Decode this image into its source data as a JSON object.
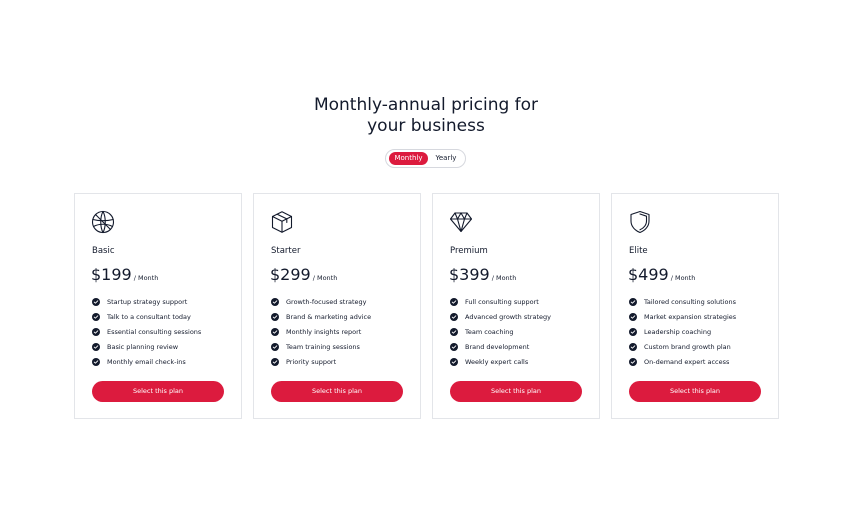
{
  "header": {
    "title_line1": "Monthly-annual pricing for",
    "title_line2": "your business"
  },
  "billing_toggle": {
    "monthly_label": "Monthly",
    "yearly_label": "Yearly",
    "selected": "Monthly"
  },
  "colors": {
    "accent": "#dc1b3e",
    "text": "#131a2c",
    "card_border": "#e3e5e9"
  },
  "plans": [
    {
      "icon": "dribbble-ball-icon",
      "name": "Basic",
      "price": "$199",
      "period": "/ Month",
      "features": [
        "Startup strategy support",
        "Talk to a consultant today",
        "Essential consulting sessions",
        "Basic planning review",
        "Monthly email check-ins"
      ],
      "cta": "Select this plan"
    },
    {
      "icon": "box-icon",
      "name": "Starter",
      "price": "$299",
      "period": "/ Month",
      "features": [
        "Growth-focused strategy",
        "Brand & marketing advice",
        "Monthly insights report",
        "Team training sessions",
        "Priority support"
      ],
      "cta": "Select this plan"
    },
    {
      "icon": "diamond-icon",
      "name": "Premium",
      "price": "$399",
      "period": "/ Month",
      "features": [
        "Full consulting support",
        "Advanced growth strategy",
        "Team coaching",
        "Brand development",
        "Weekly expert calls"
      ],
      "cta": "Select this plan"
    },
    {
      "icon": "shield-icon",
      "name": "Elite",
      "price": "$499",
      "period": "/ Month",
      "features": [
        "Tailored consulting solutions",
        "Market expansion strategies",
        "Leadership coaching",
        "Custom brand growth plan",
        "On-demand expert access"
      ],
      "cta": "Select this plan"
    }
  ]
}
